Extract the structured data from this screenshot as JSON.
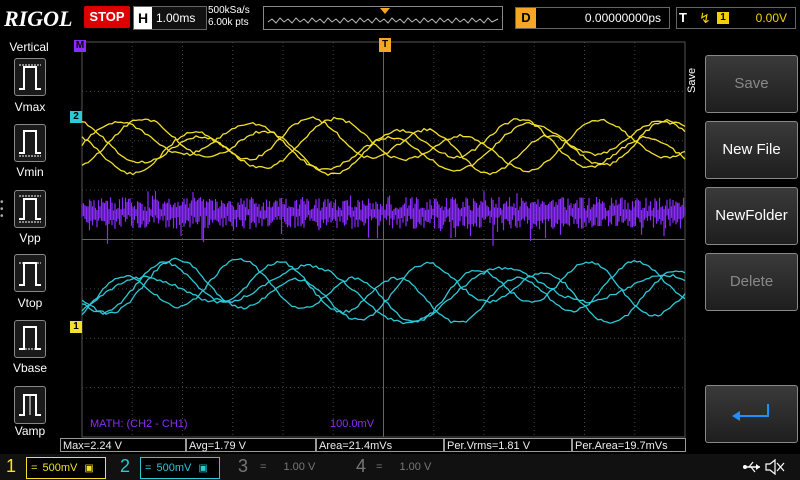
{
  "header": {
    "logo": "RIGOL",
    "run_state": "STOP",
    "timebase_label": "H",
    "timebase": "1.00ms",
    "sample_rate": "500kSa/s",
    "mem_depth": "6.00k pts",
    "delay_label": "D",
    "delay_value": "0.00000000ps",
    "trigger_label": "T",
    "trigger_edge": "↯",
    "trigger_source": "1",
    "trigger_level": "0.00V",
    "trigger_marker": "T"
  },
  "left_panel": {
    "title": "Vertical",
    "items": [
      "Vmax",
      "Vmin",
      "Vpp",
      "Vtop",
      "Vbase",
      "Vamp"
    ]
  },
  "screen": {
    "ch2_marker": "2",
    "ch1_marker": "1",
    "math_marker": "M",
    "math_label": "MATH: (CH2 - CH1)",
    "math_scale": "100.0mV",
    "trig_level_marker": "T"
  },
  "right_menu": {
    "tab": "Save",
    "buttons": [
      {
        "label": "Save",
        "enabled": false
      },
      {
        "label": "New File",
        "enabled": true
      },
      {
        "label": "NewFolder",
        "enabled": true
      },
      {
        "label": "Delete",
        "enabled": false
      }
    ],
    "enter_icon": "return-icon"
  },
  "measurements": [
    "Max=2.24 V",
    "Avg=1.79 V",
    "Area=21.4mVs",
    "Per.Vrms=1.81 V",
    "Per.Area=19.7mVs"
  ],
  "channels": [
    {
      "num": "1",
      "coupling": "=",
      "scale": "500mV",
      "color": "#f5e11a"
    },
    {
      "num": "2",
      "coupling": "=",
      "scale": "500mV",
      "color": "#20d0e0"
    },
    {
      "num": "3",
      "coupling": "=",
      "scale": "1.00 V",
      "color": "#777777"
    },
    {
      "num": "4",
      "coupling": "=",
      "scale": "1.00 V",
      "color": "#777777"
    }
  ],
  "colors": {
    "ch1": "#f2e02a",
    "ch2": "#2cc9d6",
    "math": "#8b2cff",
    "accent": "#f5a623",
    "stop": "#dd0000"
  },
  "status_icons": [
    "usb-icon",
    "sound-muted-icon"
  ]
}
